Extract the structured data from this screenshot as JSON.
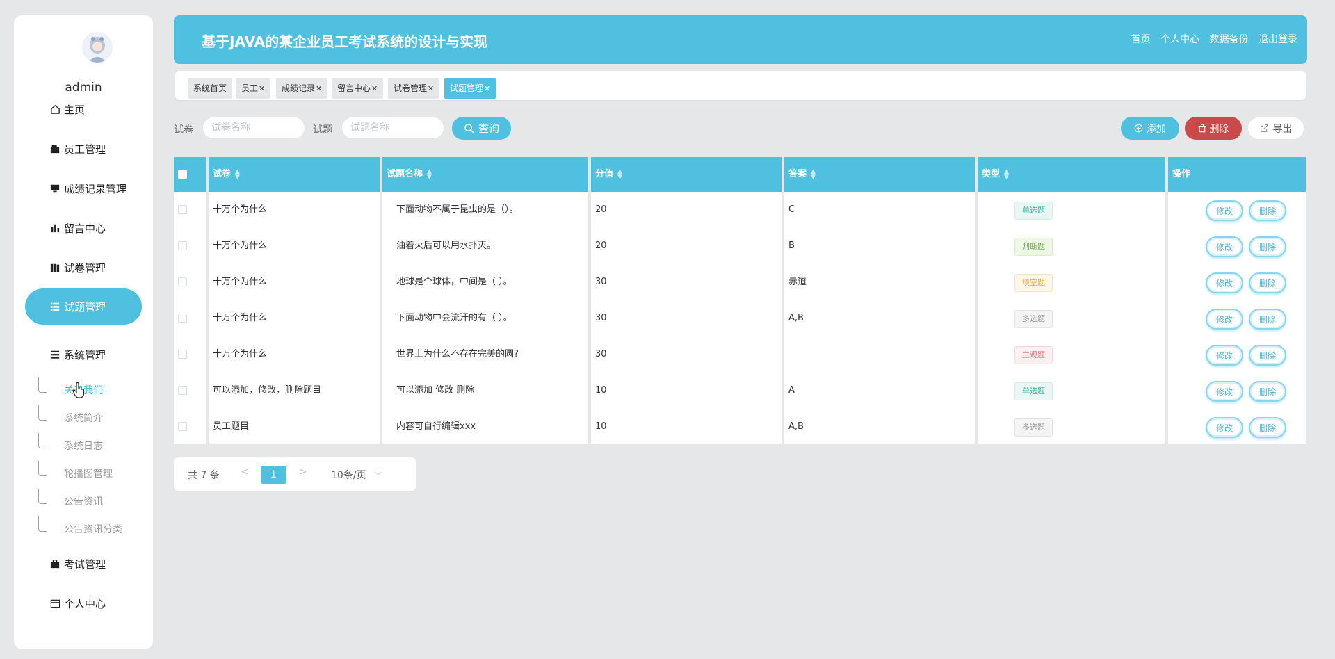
{
  "app": {
    "title": "基于JAVA的某企业员工考试系统的设计与实现"
  },
  "header": {
    "links": [
      "首页",
      "个人中心",
      "数据备份",
      "退出登录"
    ]
  },
  "user": {
    "name": "admin"
  },
  "sidebar": {
    "items": [
      {
        "label": "主页",
        "icon": "home-icon"
      },
      {
        "label": "员工管理",
        "icon": "wallet-icon"
      },
      {
        "label": "成绩记录管理",
        "icon": "monitor-icon"
      },
      {
        "label": "留言中心",
        "icon": "chart-icon"
      },
      {
        "label": "试卷管理",
        "icon": "book-icon"
      },
      {
        "label": "试题管理",
        "icon": "list-icon",
        "active": true
      },
      {
        "label": "系统管理",
        "icon": "menu-icon"
      },
      {
        "label": "考试管理",
        "icon": "briefcase-icon"
      },
      {
        "label": "个人中心",
        "icon": "card-icon"
      }
    ],
    "subitems": [
      "关于我们",
      "系统简介",
      "系统日志",
      "轮播图管理",
      "公告资讯",
      "公告资讯分类"
    ]
  },
  "tabs": [
    "系统首页",
    "员工",
    "成绩记录",
    "留言中心",
    "试卷管理",
    "试题管理"
  ],
  "search": {
    "paper_label": "试卷",
    "paper_placeholder": "试卷名称",
    "question_label": "试题",
    "question_placeholder": "试题名称",
    "query_button": "查询"
  },
  "actions": {
    "add": "添加",
    "delete": "删除",
    "export": "导出"
  },
  "table": {
    "columns": [
      "试卷",
      "试题名称",
      "分值",
      "答案",
      "类型",
      "操作"
    ],
    "rows": [
      {
        "paper": "十万个为什么",
        "question": "下面动物不属于昆虫的是（）。",
        "score": "20",
        "answer": "C",
        "type": "单选题",
        "type_style": "single"
      },
      {
        "paper": "十万个为什么",
        "question": "油着火后可以用水扑灭。",
        "score": "20",
        "answer": "B",
        "type": "判断题",
        "type_style": "judge"
      },
      {
        "paper": "十万个为什么",
        "question": "地球是个球体，中间是（ ）。",
        "score": "30",
        "answer": "赤道",
        "type": "填空题",
        "type_style": "fill"
      },
      {
        "paper": "十万个为什么",
        "question": "下面动物中会流汗的有（ ）。",
        "score": "30",
        "answer": "A,B",
        "type": "多选题",
        "type_style": "multi"
      },
      {
        "paper": "十万个为什么",
        "question": "世界上为什么不存在完美的圆?",
        "score": "30",
        "answer": "",
        "type": "主观题",
        "type_style": "subj"
      },
      {
        "paper": "可以添加，修改，删除题目",
        "question": "可以添加 修改 删除",
        "score": "10",
        "answer": "A",
        "type": "单选题",
        "type_style": "single"
      },
      {
        "paper": "员工题目",
        "question": "内容可自行编辑xxx",
        "score": "10",
        "answer": "A,B",
        "type": "多选题",
        "type_style": "multi"
      }
    ],
    "edit_label": "修改",
    "delete_label": "删除"
  },
  "pagination": {
    "total": "共 7 条",
    "prev": "<",
    "current": "1",
    "next": ">",
    "page_size": "10条/页"
  },
  "colors": {
    "accent": "#4fc0df",
    "danger": "#c94a4a",
    "background": "#e5e7e8"
  }
}
